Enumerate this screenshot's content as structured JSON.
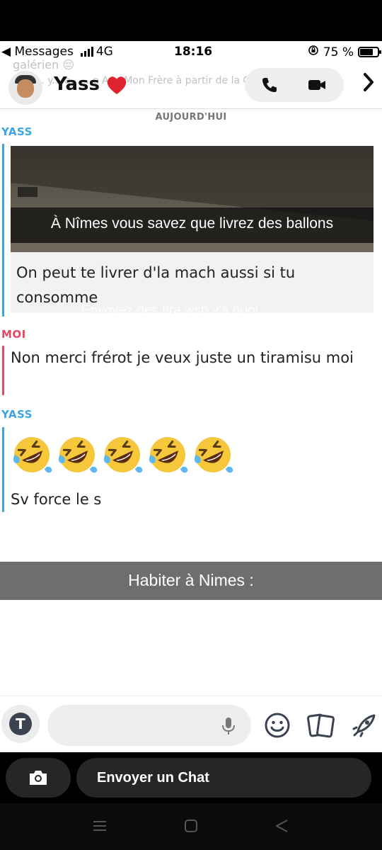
{
  "status_bar": {
    "back_app": "◀ Messages",
    "network": "4G",
    "time": "18:16",
    "battery": "75 %",
    "battery_level": 0.75
  },
  "header": {
    "contact_name": "Yass",
    "ghost_text_1": "galérien 😔",
    "ghost_text_2": "A... y... a... ...e   Aaa.Mon Frère  à partir de la Galerie"
  },
  "chat": {
    "date_label": "AUJOURD'HUI",
    "sender_yass": "YASS",
    "sender_me": "MOI",
    "snap_caption": "À Nîmes vous savez que livrez des ballons",
    "snap_ghost_text": "Envoyez des tira wsh y'a quoi",
    "msg_1": "On peut te livrer d'la mach aussi si tu consomme",
    "msg_2": "Non merci frérot je veux juste un tiramisu moi",
    "emoji_count": 5,
    "msg_3": "Sv force le s"
  },
  "banner": {
    "text": "Habiter à Nimes :"
  },
  "composer": {
    "placeholder": ""
  },
  "bottom": {
    "send_chat_label": "Envoyer un Chat"
  },
  "colors": {
    "blue_sender": "#3aa5e2",
    "red_sender": "#e94763",
    "banner_bg": "#6e6e6e"
  }
}
